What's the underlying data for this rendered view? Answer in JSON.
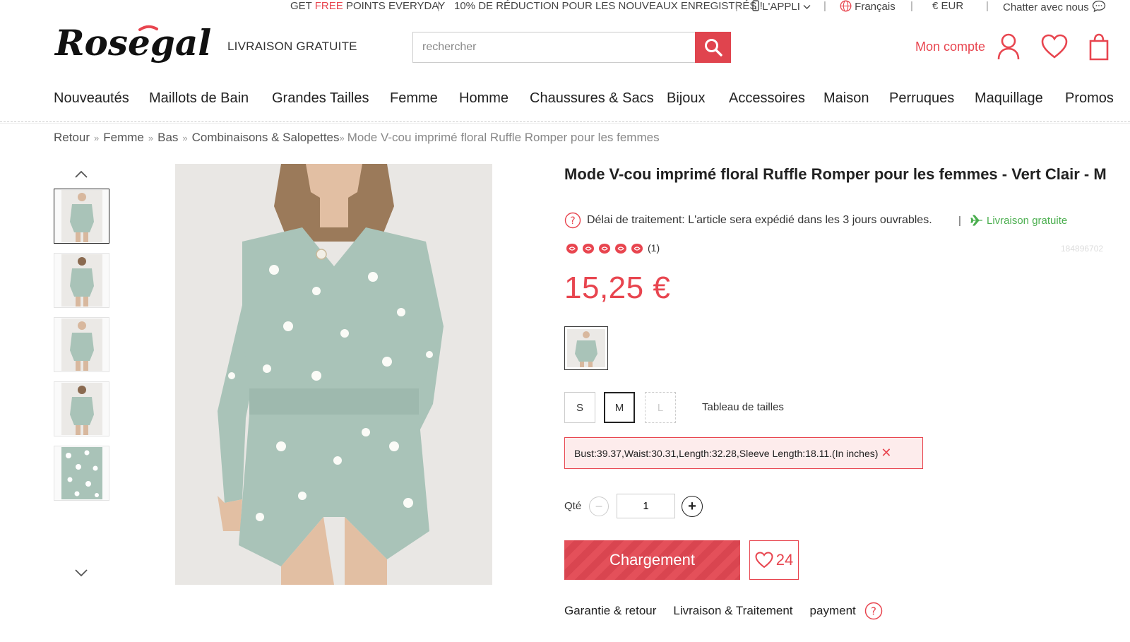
{
  "topbar": {
    "get": "GET",
    "free": "FREE",
    "points": "POINTS EVERYDAY",
    "discount": "10% DE RÉDUCTION POUR LES NOUVEAUX ENREGISTRÉS !",
    "app": "L'APPLI",
    "language": "Français",
    "currency": "€ EUR",
    "chat": "Chatter avec nous",
    "separator": "|"
  },
  "header": {
    "logo_text": "Rosegal",
    "free_shipping": "LIVRAISON GRATUITE",
    "search_placeholder": "rechercher",
    "account": "Mon compte"
  },
  "nav": [
    "Nouveautés",
    "Maillots de Bain",
    "Grandes Tailles",
    "Femme",
    "Homme",
    "Chaussures & Sacs",
    "Bijoux",
    "Accessoires",
    "Maison",
    "Perruques",
    "Maquillage",
    "Promos"
  ],
  "breadcrumb": {
    "items": [
      "Retour",
      "Femme",
      "Bas",
      "Combinaisons & Salopettes"
    ],
    "separator": "»",
    "current": "Mode V-cou imprimé floral Ruffle Romper pour les femmes"
  },
  "product": {
    "title": "Mode V-cou imprimé floral Ruffle Romper pour les femmes - Vert Clair - M",
    "processing": "Délai de traitement: L'article sera expédié dans les 3 jours ouvrables.",
    "free_shipping": "Livraison gratuite",
    "pipe": "|",
    "rating": 5,
    "review_count": "(1)",
    "sku": "184896702",
    "price": "15,25 €",
    "sizes": [
      {
        "label": "S",
        "state": "normal"
      },
      {
        "label": "M",
        "state": "selected"
      },
      {
        "label": "L",
        "state": "disabled"
      }
    ],
    "size_chart": "Tableau de tailles",
    "size_info": "Bust:39.37,Waist:30.31,Length:32.28,Sleeve Length:18.11.(In inches)",
    "size_info_close": "✕",
    "qty_label": "Qté",
    "qty_value": "1",
    "qty_minus": "−",
    "qty_plus": "+",
    "cart_label": "Chargement",
    "wish_count": "24",
    "bottom_tabs": [
      "Garantie & retour",
      "Livraison & Traitement",
      "payment"
    ]
  },
  "colors": {
    "accent": "#e8454f",
    "green": "#4caf50",
    "garment": "#a9c3b8"
  }
}
